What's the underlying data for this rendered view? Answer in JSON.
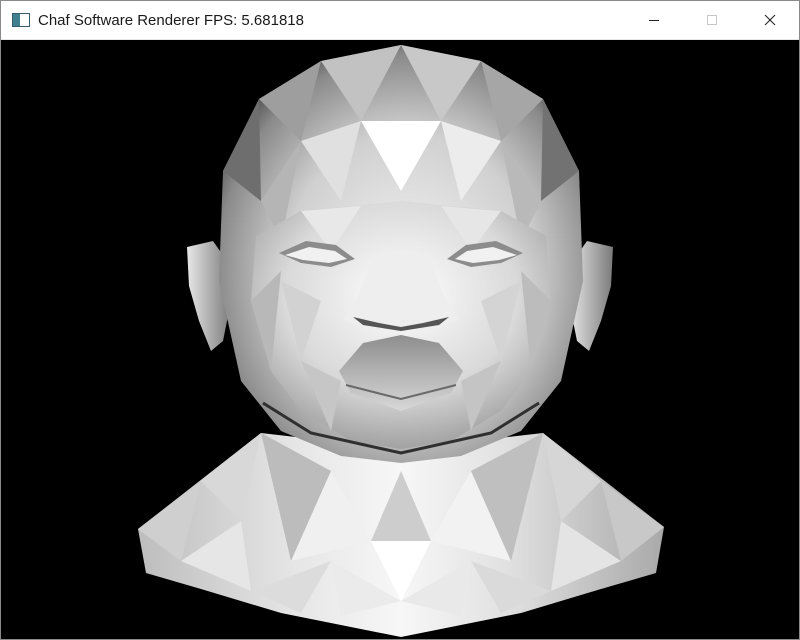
{
  "window": {
    "title": "Chaf Software Renderer FPS: 5.681818",
    "app_icon": "app-window-icon"
  },
  "controls": {
    "minimize": "minimize-icon",
    "maximize": "maximize-icon",
    "close": "close-icon"
  },
  "viewport": {
    "background": "#000000",
    "scene": "flat-shaded gray 3D head mesh"
  }
}
